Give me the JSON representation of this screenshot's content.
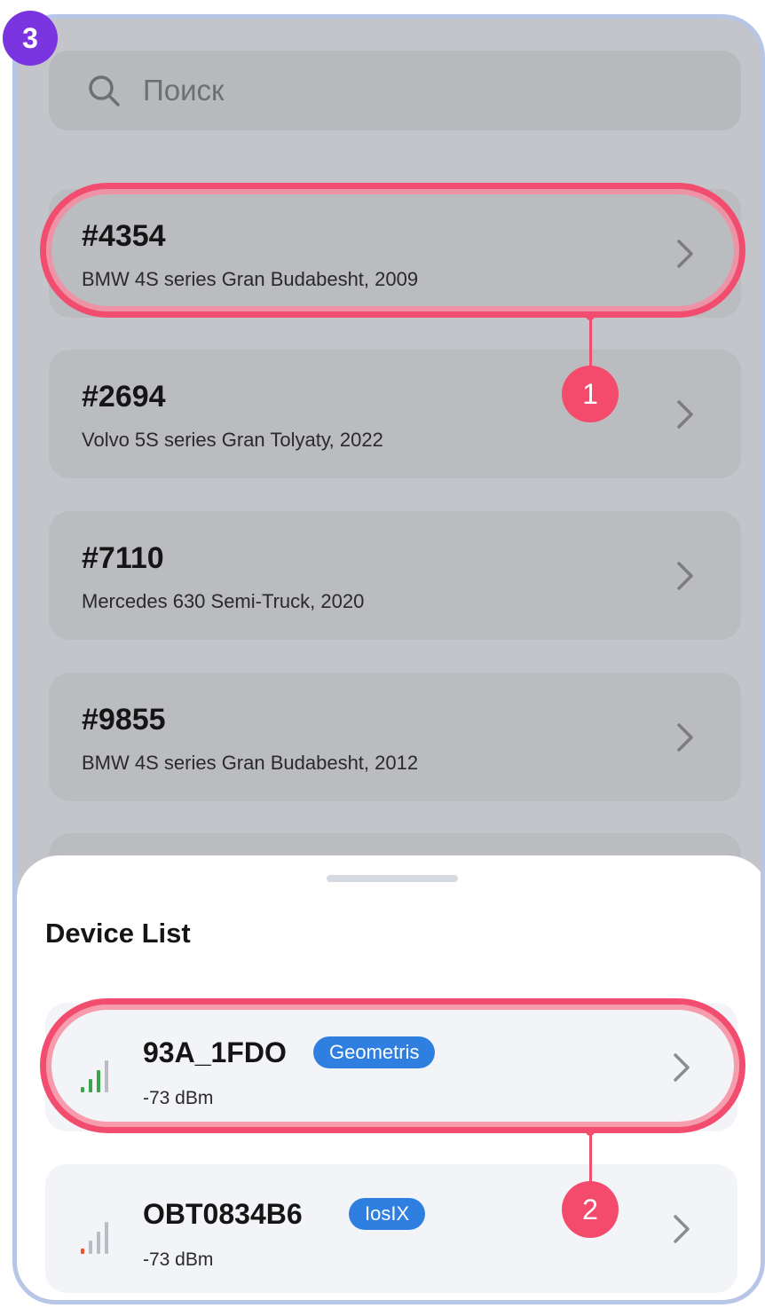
{
  "step_badge": "3",
  "search": {
    "placeholder": "Поиск",
    "icon": "search-icon"
  },
  "vehicles": [
    {
      "id": "#4354",
      "description": "BMW 4S series Gran Budabesht, 2009"
    },
    {
      "id": "#2694",
      "description": "Volvo 5S series Gran Tolyatу, 2022"
    },
    {
      "id": "#7110",
      "description": "Mercedes 630 Semi-Truck, 2020"
    },
    {
      "id": "#9855",
      "description": "BMW 4S series Gran Budabesht, 2012"
    }
  ],
  "device_sheet": {
    "title": "Device List",
    "devices": [
      {
        "name": "93A_1FDO",
        "tag": "Geometris",
        "rssi": "-73 dBm",
        "signal_color": "#3aa54a"
      },
      {
        "name": "OBT0834B6",
        "tag": "IosIX",
        "rssi": "-73 dBm",
        "signal_color": "#f0552a"
      }
    ]
  },
  "callouts": [
    "1",
    "2"
  ],
  "colors": {
    "highlight": "#f24d6e",
    "step_badge": "#7a35e0",
    "tag": "#2f7fe0",
    "frame": "#b7c6e6"
  }
}
